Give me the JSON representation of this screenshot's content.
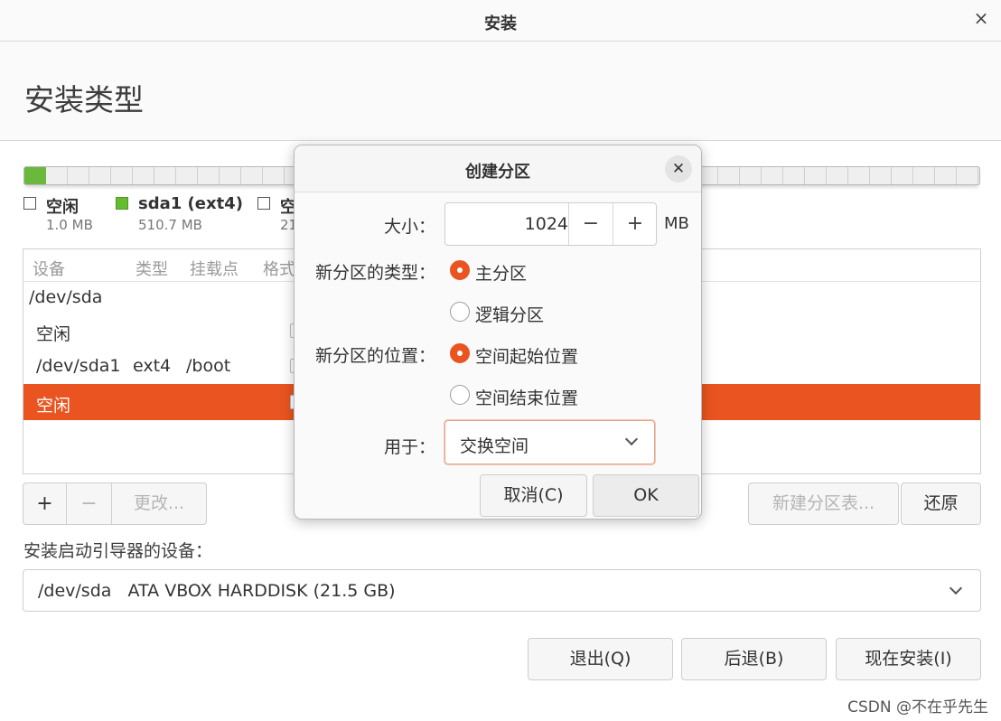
{
  "window": {
    "title": "安装",
    "close_glyph": "×"
  },
  "page": {
    "title": "安装类型"
  },
  "partition_bar": {
    "used_color": "#6ab93c"
  },
  "legend": [
    {
      "name": "空闲",
      "size": "1.0 MB",
      "color": "white"
    },
    {
      "name": "sda1 (ext4)",
      "size": "510.7 MB",
      "color": "#66bb33"
    },
    {
      "name": "空",
      "size": "21",
      "color": "white"
    }
  ],
  "table": {
    "headers": [
      "设备",
      "类型",
      "挂载点",
      "格式"
    ],
    "rows": [
      {
        "device": "/dev/sda",
        "type": "",
        "mount": "",
        "selected": false
      },
      {
        "device": "空闲",
        "type": "",
        "mount": "",
        "selected": false
      },
      {
        "device": "/dev/sda1",
        "type": "ext4",
        "mount": "/boot",
        "selected": false
      },
      {
        "device": "空闲",
        "type": "",
        "mount": "",
        "selected": true
      }
    ]
  },
  "table_buttons": {
    "add": "+",
    "remove": "−",
    "change": "更改..."
  },
  "right_buttons": {
    "new_table": "新建分区表...",
    "revert": "还原"
  },
  "bootloader": {
    "label": "安装启动引导器的设备：",
    "value": "/dev/sda   ATA VBOX HARDDISK (21.5 GB)"
  },
  "footer": {
    "quit": "退出(Q)",
    "back": "后退(B)",
    "install_now": "现在安装(I)"
  },
  "watermark": "CSDN @不在乎先生",
  "accent_color": "#e95420",
  "dialog": {
    "title": "创建分区",
    "close_glyph": "✕",
    "size_label": "大小：",
    "size_value": "1024",
    "minus": "−",
    "plus": "+",
    "unit": "MB",
    "type_label": "新分区的类型：",
    "type_options": [
      {
        "label": "主分区",
        "checked": true
      },
      {
        "label": "逻辑分区",
        "checked": false
      }
    ],
    "location_label": "新分区的位置：",
    "location_options": [
      {
        "label": "空间起始位置",
        "checked": true
      },
      {
        "label": "空间结束位置",
        "checked": false
      }
    ],
    "use_label": "用于：",
    "use_value": "交换空间",
    "cancel": "取消(C)",
    "ok": "OK"
  }
}
